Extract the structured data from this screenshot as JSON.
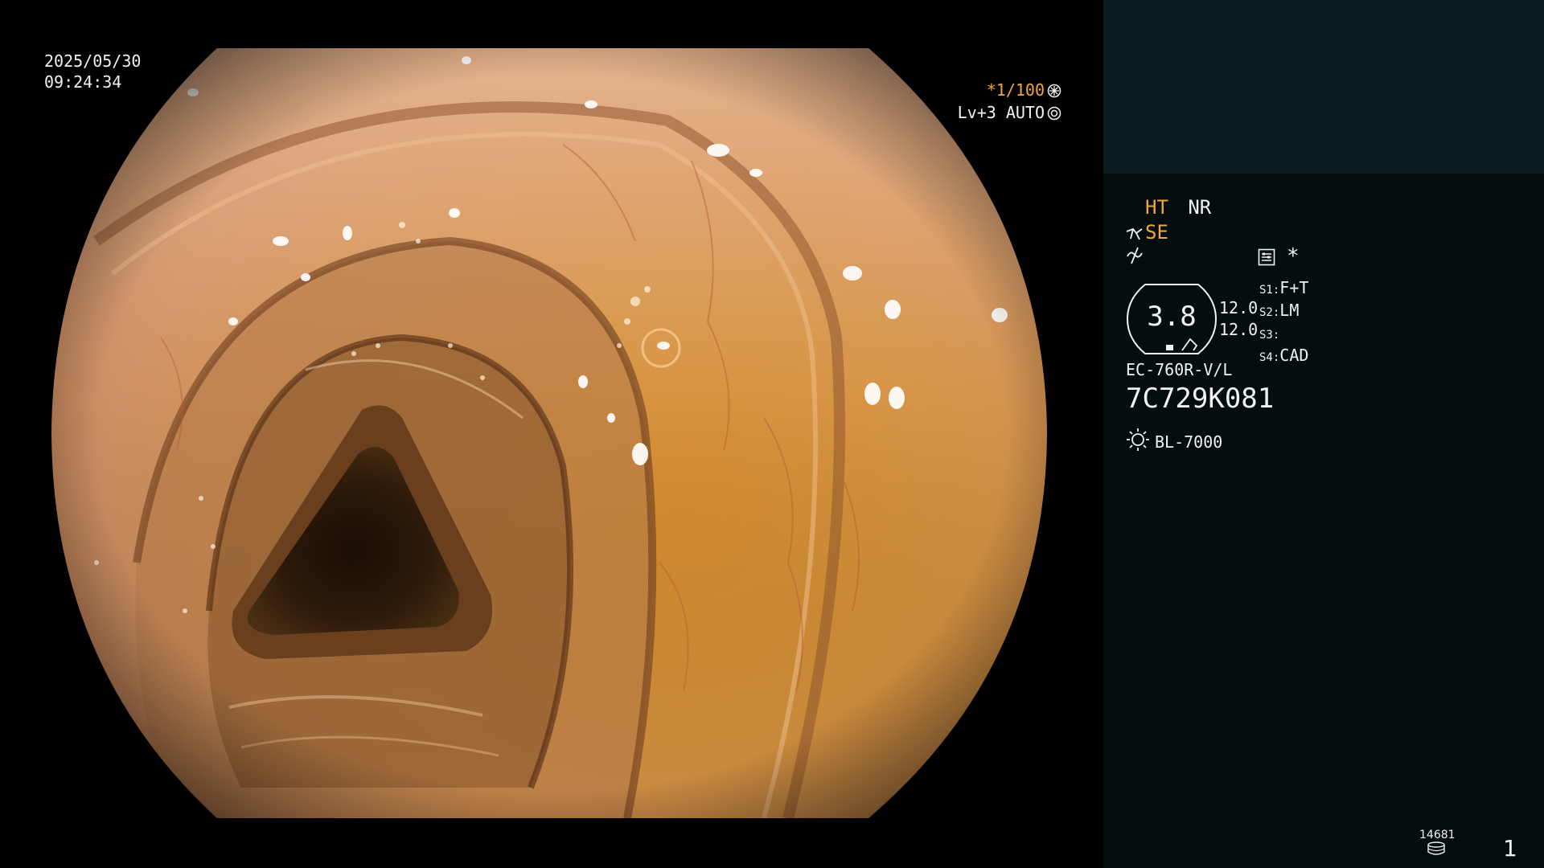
{
  "overlay": {
    "date": "2025/05/30",
    "time": "09:24:34",
    "shutter_prefix": "*",
    "shutter_value": "1/100",
    "level": "Lv+3",
    "exposure_mode": "AUTO"
  },
  "panel": {
    "modes": {
      "ht": "HT",
      "nr": "NR",
      "se": "SE"
    },
    "asterisk": "*",
    "gauge": {
      "value": "3.8",
      "upper": "12.0",
      "lower": "12.0"
    },
    "switches": [
      {
        "key": "S1",
        "value": "F+T"
      },
      {
        "key": "S2",
        "value": "LM"
      },
      {
        "key": "S3",
        "value": ""
      },
      {
        "key": "S4",
        "value": "CAD"
      }
    ],
    "scope_model": "EC-760R-V/L",
    "serial": "7C729K081",
    "light_source": "BL-7000",
    "counter": "14681",
    "page": "1"
  },
  "colors": {
    "accent": "#f0a640",
    "text": "#f2f2f2",
    "panel_bg": "#050e0e",
    "panel_top_bg": "#0a1e20",
    "background": "#000000"
  }
}
